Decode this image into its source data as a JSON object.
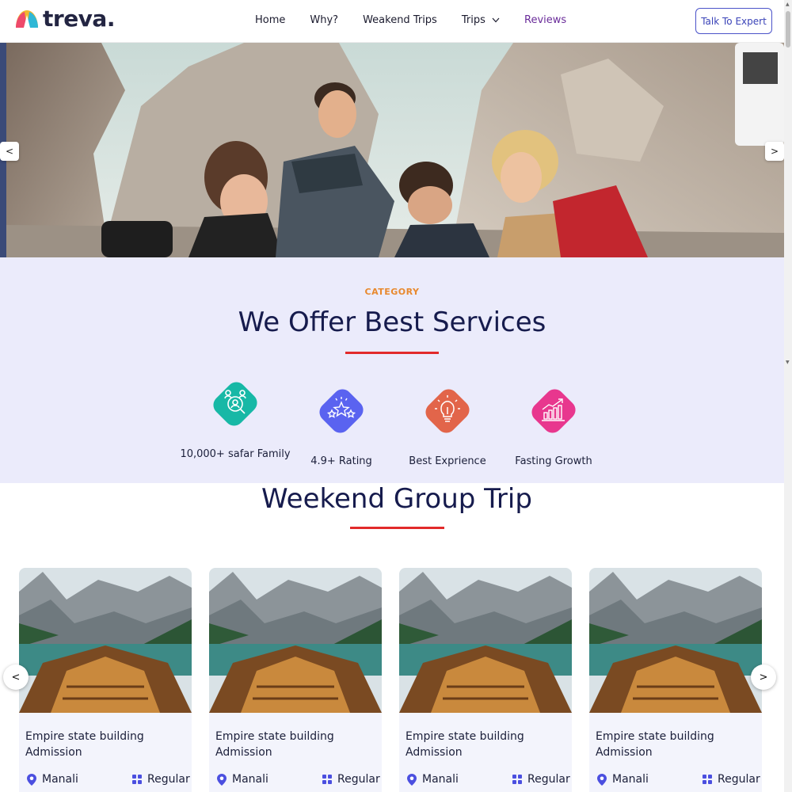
{
  "brand": {
    "name": "treva."
  },
  "nav": {
    "items": [
      {
        "label": "Home"
      },
      {
        "label": "Why?"
      },
      {
        "label": "Weakend Trips"
      },
      {
        "label": "Trips"
      },
      {
        "label": "Reviews"
      }
    ],
    "cta_label": "Talk To Expert"
  },
  "hero": {
    "prev_label": "<",
    "next_label": ">"
  },
  "services": {
    "category_label": "CATEGORY",
    "title": "We Offer Best Services",
    "items": [
      {
        "label": "10,000+ safar Family",
        "icon": "family-icon",
        "color": "#17b8a6"
      },
      {
        "label": "4.9+ Rating",
        "icon": "stars-icon",
        "color": "#5a63f0"
      },
      {
        "label": "Best Exprience",
        "icon": "bulb-icon",
        "color": "#e2654a"
      },
      {
        "label": "Fasting Growth",
        "icon": "growth-chart-icon",
        "color": "#e8378e"
      }
    ]
  },
  "weekend": {
    "title": "Weekend Group Trip",
    "prev_label": "<",
    "next_label": ">",
    "cards": [
      {
        "title": "Empire state building Admission",
        "location": "Manali",
        "type": "Regular"
      },
      {
        "title": "Empire state building Admission",
        "location": "Manali",
        "type": "Regular"
      },
      {
        "title": "Empire state building Admission",
        "location": "Manali",
        "type": "Regular"
      },
      {
        "title": "Empire state building Admission",
        "location": "Manali",
        "type": "Regular"
      }
    ]
  },
  "colors": {
    "accent_underline": "#e22a2a",
    "category_label": "#e8892e",
    "heading": "#161b4d",
    "cta_border": "#4b53c9",
    "active_nav": "#6a2c9a"
  }
}
